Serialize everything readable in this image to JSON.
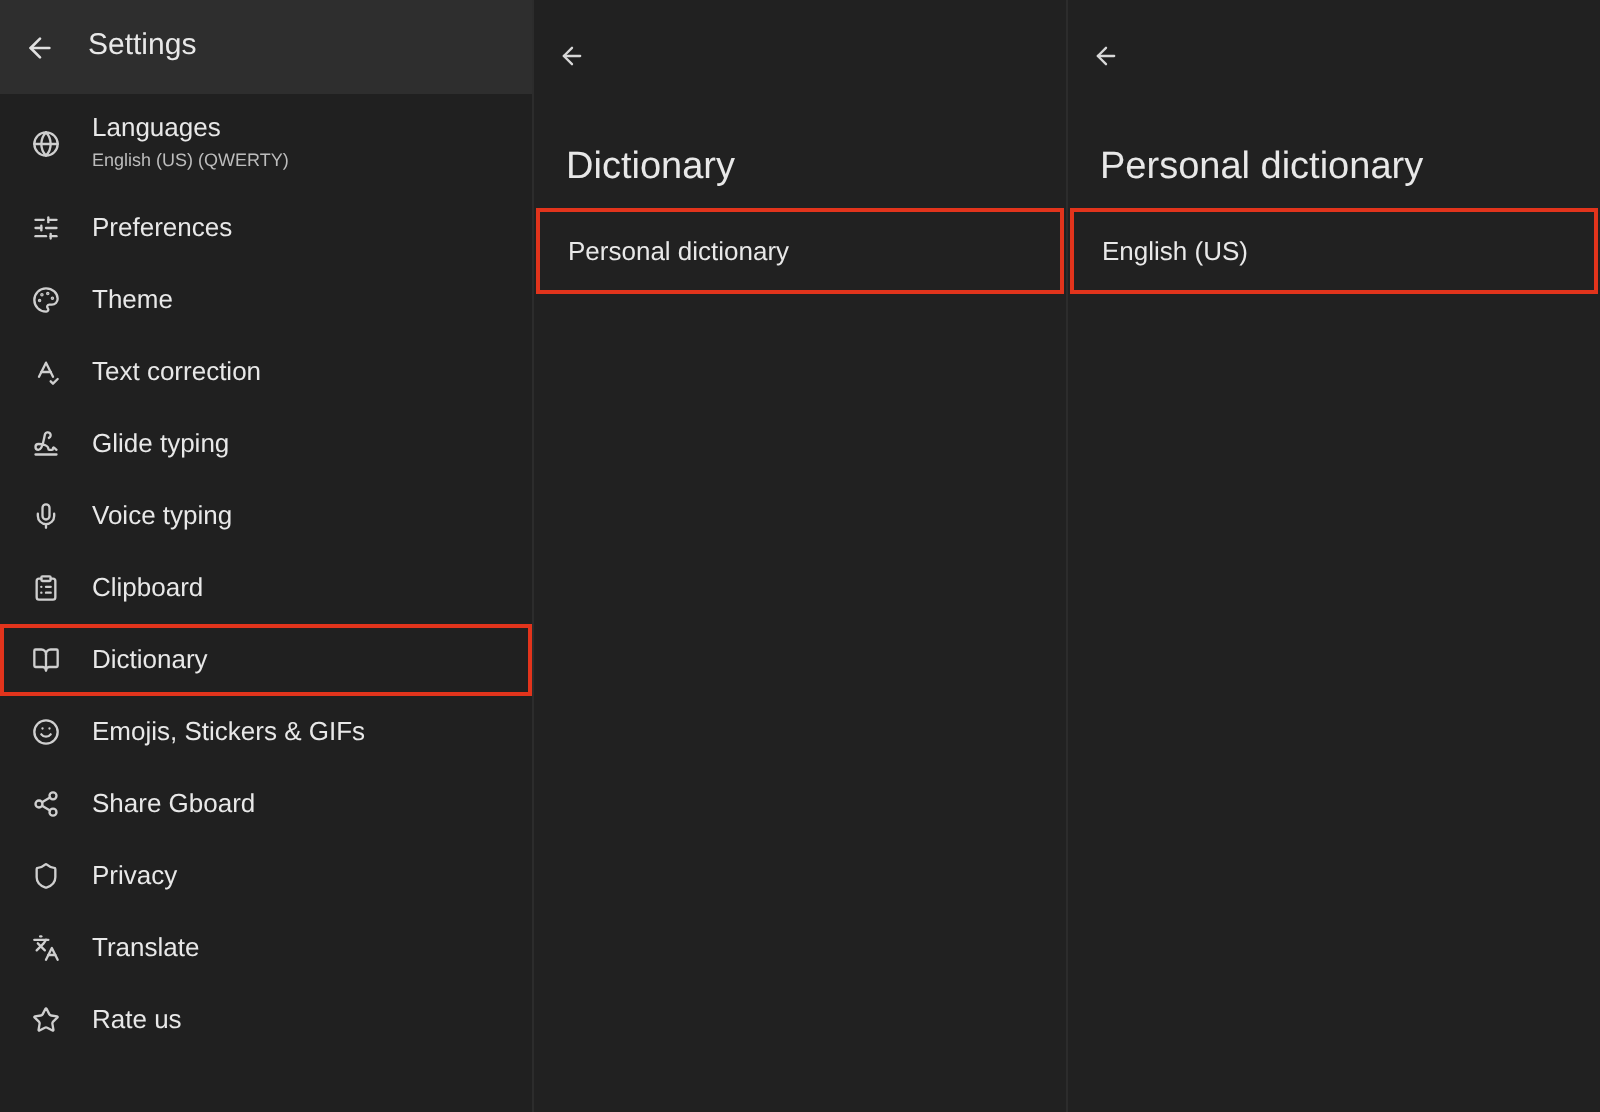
{
  "sidebar": {
    "title": "Settings",
    "items": [
      {
        "label": "Languages",
        "subtitle": "English (US) (QWERTY)",
        "highlighted": false
      },
      {
        "label": "Preferences",
        "highlighted": false
      },
      {
        "label": "Theme",
        "highlighted": false
      },
      {
        "label": "Text correction",
        "highlighted": false
      },
      {
        "label": "Glide typing",
        "highlighted": false
      },
      {
        "label": "Voice typing",
        "highlighted": false
      },
      {
        "label": "Clipboard",
        "highlighted": false
      },
      {
        "label": "Dictionary",
        "highlighted": true
      },
      {
        "label": "Emojis, Stickers & GIFs",
        "highlighted": false
      },
      {
        "label": "Share Gboard",
        "highlighted": false
      },
      {
        "label": "Privacy",
        "highlighted": false
      },
      {
        "label": "Translate",
        "highlighted": false
      },
      {
        "label": "Rate us",
        "highlighted": false
      }
    ]
  },
  "panes": [
    {
      "title": "Dictionary",
      "items": [
        {
          "label": "Personal dictionary",
          "highlighted": true
        }
      ]
    },
    {
      "title": "Personal dictionary",
      "items": [
        {
          "label": "English (US)",
          "highlighted": true
        }
      ]
    }
  ]
}
